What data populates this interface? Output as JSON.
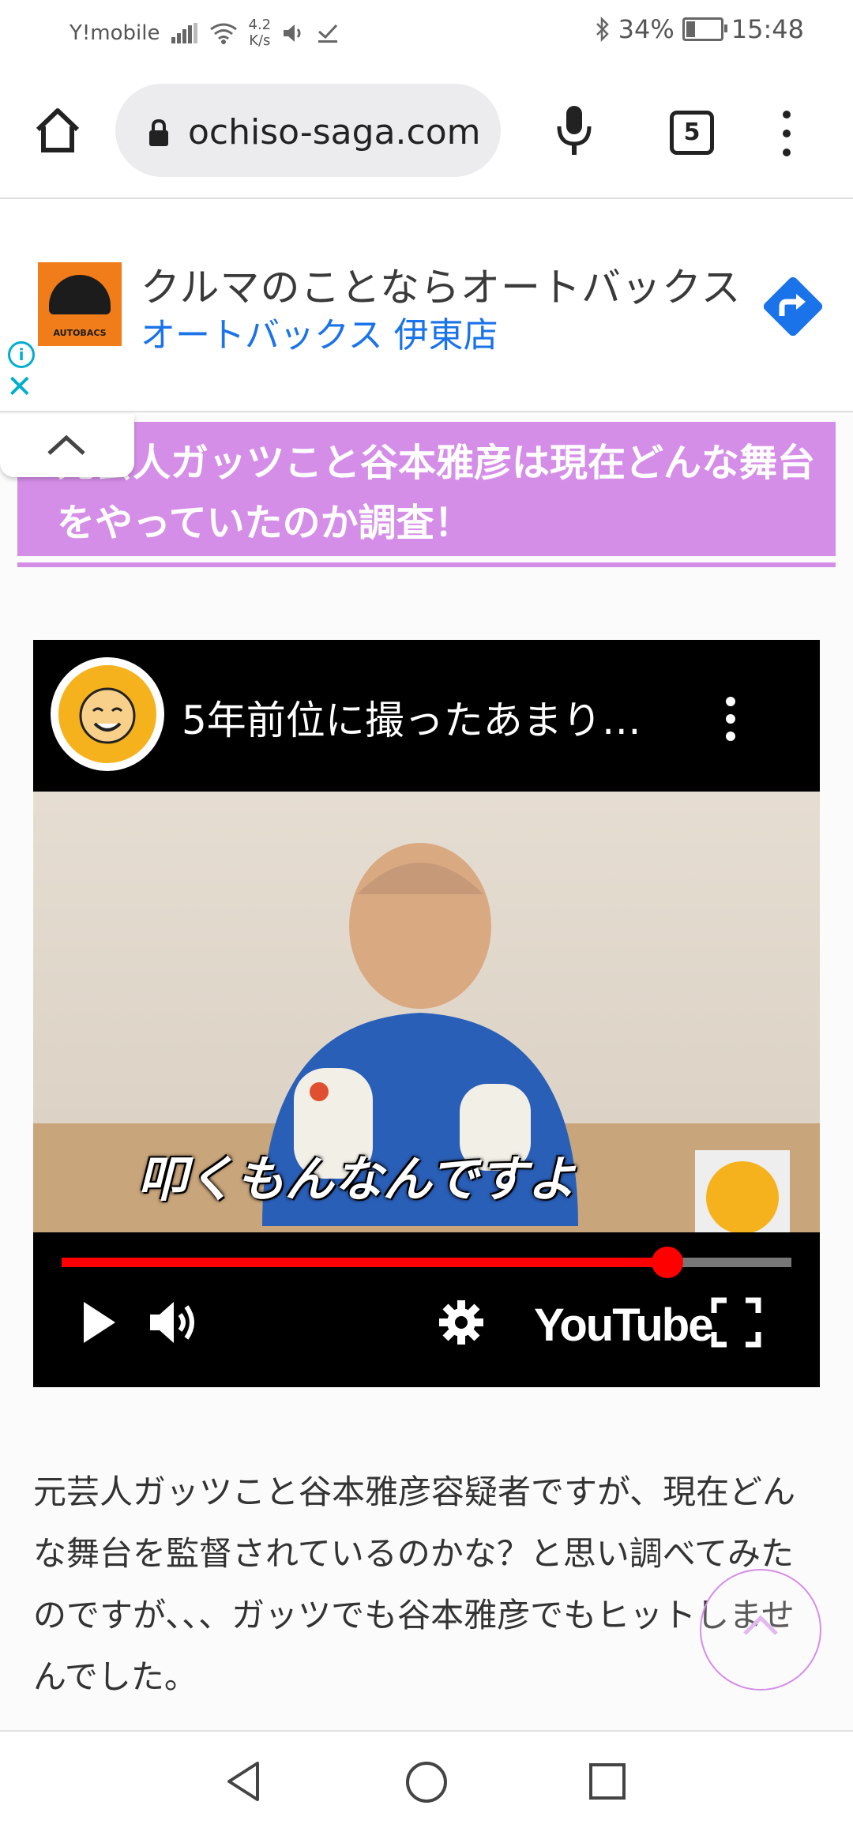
{
  "status_bar": {
    "carrier": "Y!mobile",
    "speed_value": "4.2",
    "speed_unit": "K/s",
    "battery_percent": "34%",
    "battery_level": 0.34,
    "time": "15:48"
  },
  "browser": {
    "url": "ochiso-saga.com",
    "tab_count": "5",
    "icons": [
      "home-icon",
      "lock-icon",
      "microphone-icon",
      "tab-switcher-icon",
      "more-menu-icon"
    ]
  },
  "ad": {
    "logo_text": "AUTOBACS",
    "title": "クルマのことならオートバックス",
    "subtitle": "オートバックス 伊東店",
    "accent_color": "#1a73e8",
    "info_color": "#00aecd"
  },
  "article": {
    "heading": "元芸人ガッツこと谷本雅彦は現在どんな舞台をやっていたのか調査！",
    "heading_color": "#d58ee8",
    "body": "元芸人ガッツこと谷本雅彦容疑者ですが、現在どんな舞台を監督されているのかな？と思い調べてみたのですが、、、ガッツでも谷本雅彦でもヒットしませんでした。"
  },
  "video": {
    "title": "5年前位に撮ったあまり…",
    "caption": "叩くもんなんですよ",
    "progress": 0.83,
    "logo_text": "YouTube",
    "controls": [
      "play-icon",
      "volume-icon",
      "settings-icon",
      "fullscreen-icon"
    ]
  }
}
